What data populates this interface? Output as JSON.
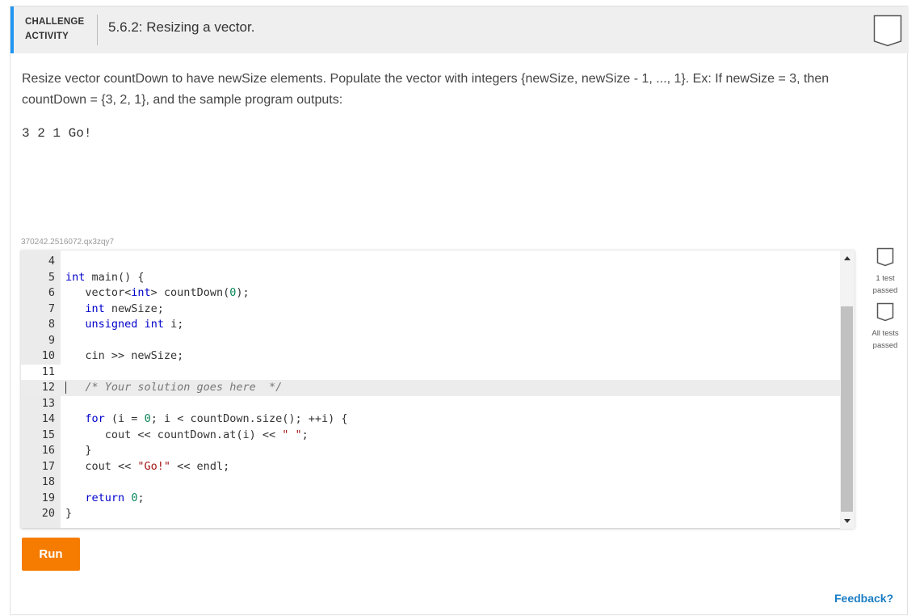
{
  "header": {
    "activity_label_line1": "CHALLENGE",
    "activity_label_line2": "ACTIVITY",
    "title": "5.6.2: Resizing a vector."
  },
  "icons": {
    "bookmark": "bookmark-icon",
    "status": "checkbox-icon"
  },
  "description": {
    "text": "Resize vector countDown to have newSize elements. Populate the vector with integers {newSize, newSize - 1, ..., 1}. Ex: If newSize = 3, then countDown = {3, 2, 1}, and the sample program outputs:",
    "sample_output": "3 2 1 Go!"
  },
  "challenge_id": "370242.2516072.qx3zqy7",
  "editor": {
    "lines": [
      {
        "num": "4",
        "code": ""
      },
      {
        "num": "5",
        "code": "int main() {"
      },
      {
        "num": "6",
        "code": "   vector<int> countDown(0);"
      },
      {
        "num": "7",
        "code": "   int newSize;"
      },
      {
        "num": "8",
        "code": "   unsigned int i;"
      },
      {
        "num": "9",
        "code": ""
      },
      {
        "num": "10",
        "code": "   cin >> newSize;"
      },
      {
        "num": "11",
        "code": ""
      },
      {
        "num": "12",
        "code": "   /* Your solution goes here  */"
      },
      {
        "num": "13",
        "code": ""
      },
      {
        "num": "14",
        "code": "   for (i = 0; i < countDown.size(); ++i) {"
      },
      {
        "num": "15",
        "code": "      cout << countDown.at(i) << \" \";"
      },
      {
        "num": "16",
        "code": "   }"
      },
      {
        "num": "17",
        "code": "   cout << \"Go!\" << endl;"
      },
      {
        "num": "18",
        "code": ""
      },
      {
        "num": "19",
        "code": "   return 0;"
      },
      {
        "num": "20",
        "code": "}"
      }
    ],
    "active_line": "12"
  },
  "tests": [
    {
      "label_line1": "1 test",
      "label_line2": "passed"
    },
    {
      "label_line1": "All tests",
      "label_line2": "passed"
    }
  ],
  "run_label": "Run",
  "feedback_label": "Feedback?",
  "colors": {
    "accent": "#2196f3",
    "run_button": "#f57c00",
    "feedback_link": "#1a7dc4",
    "keyword": "#0000cc",
    "string": "#a31515",
    "number": "#098658",
    "comment": "#777777"
  }
}
